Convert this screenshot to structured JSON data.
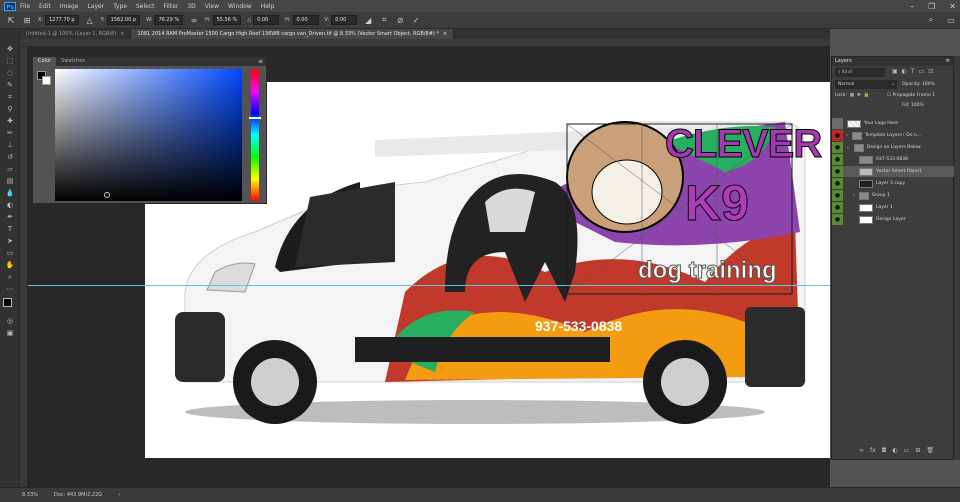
{
  "menu": {
    "app_logo": "Ps",
    "items": [
      "File",
      "Edit",
      "Image",
      "Layer",
      "Type",
      "Select",
      "Filter",
      "3D",
      "View",
      "Window",
      "Help"
    ]
  },
  "options": {
    "x_label": "X:",
    "x_value": "1277.70 p",
    "y_label": "Y:",
    "y_value": "1562.00 p",
    "w_label": "W:",
    "w_value": "76.29 %",
    "h_label": "H:",
    "h_value": "55.56 %",
    "angle_label": "△",
    "angle_value": "0.00",
    "h_skew_label": "H:",
    "h_skew_value": "0.00",
    "v_skew_label": "V:",
    "v_skew_value": "0.00"
  },
  "tabs": [
    {
      "label": "Untitled-1 @ 100% (Layer 1, RGB/8)",
      "active": false
    },
    {
      "label": "1081 2014 RAM ProMaster 1500 Cargo High Roof 136WB cargo van_Driven.tif @ 8.33% (Vector Smart Object, RGB/8#) *",
      "active": true
    }
  ],
  "canvas_art": {
    "brand_line1": "CLEVER",
    "brand_line2": "K9",
    "tagline": "dog training",
    "phone": "937-533-0838"
  },
  "color_panel": {
    "tab_color": "Color",
    "tab_swatches": "Swatches"
  },
  "layers_panel": {
    "title": "Layers",
    "filter_kind": "Kind",
    "blend_mode": "Normal",
    "opacity_label": "Opacity:",
    "opacity_value": "100%",
    "lock_label": "Lock:",
    "propagate": "Propagate Frame 1",
    "fill_label": "Fill:",
    "fill_value": "100%",
    "layers": [
      {
        "name": "Your Logo Here",
        "visible": false,
        "selected": false,
        "eye_color": "#6b6b6b"
      },
      {
        "name": "Template Layers ( Do n...",
        "visible": true,
        "selected": false,
        "eye_color": "#c5262c"
      },
      {
        "name": "Design on Layers Below",
        "visible": true,
        "selected": false,
        "eye_color": "#5c8a2e"
      },
      {
        "name": "937-533-0838",
        "visible": true,
        "selected": false,
        "eye_color": "#5c8a2e"
      },
      {
        "name": "Vector Smart Object",
        "visible": true,
        "selected": true,
        "eye_color": "#5c8a2e"
      },
      {
        "name": "Layer 3 copy",
        "visible": true,
        "selected": false,
        "eye_color": "#5c8a2e"
      },
      {
        "name": "Group 1",
        "visible": true,
        "selected": false,
        "eye_color": "#5c8a2e"
      },
      {
        "name": "Layer 1",
        "visible": true,
        "selected": false,
        "eye_color": "#5c8a2e"
      },
      {
        "name": "Design Layer",
        "visible": true,
        "selected": false,
        "eye_color": "#5c8a2e"
      }
    ]
  },
  "status": {
    "zoom": "8.33%",
    "doc": "Doc: 443.9M/2.22G"
  }
}
